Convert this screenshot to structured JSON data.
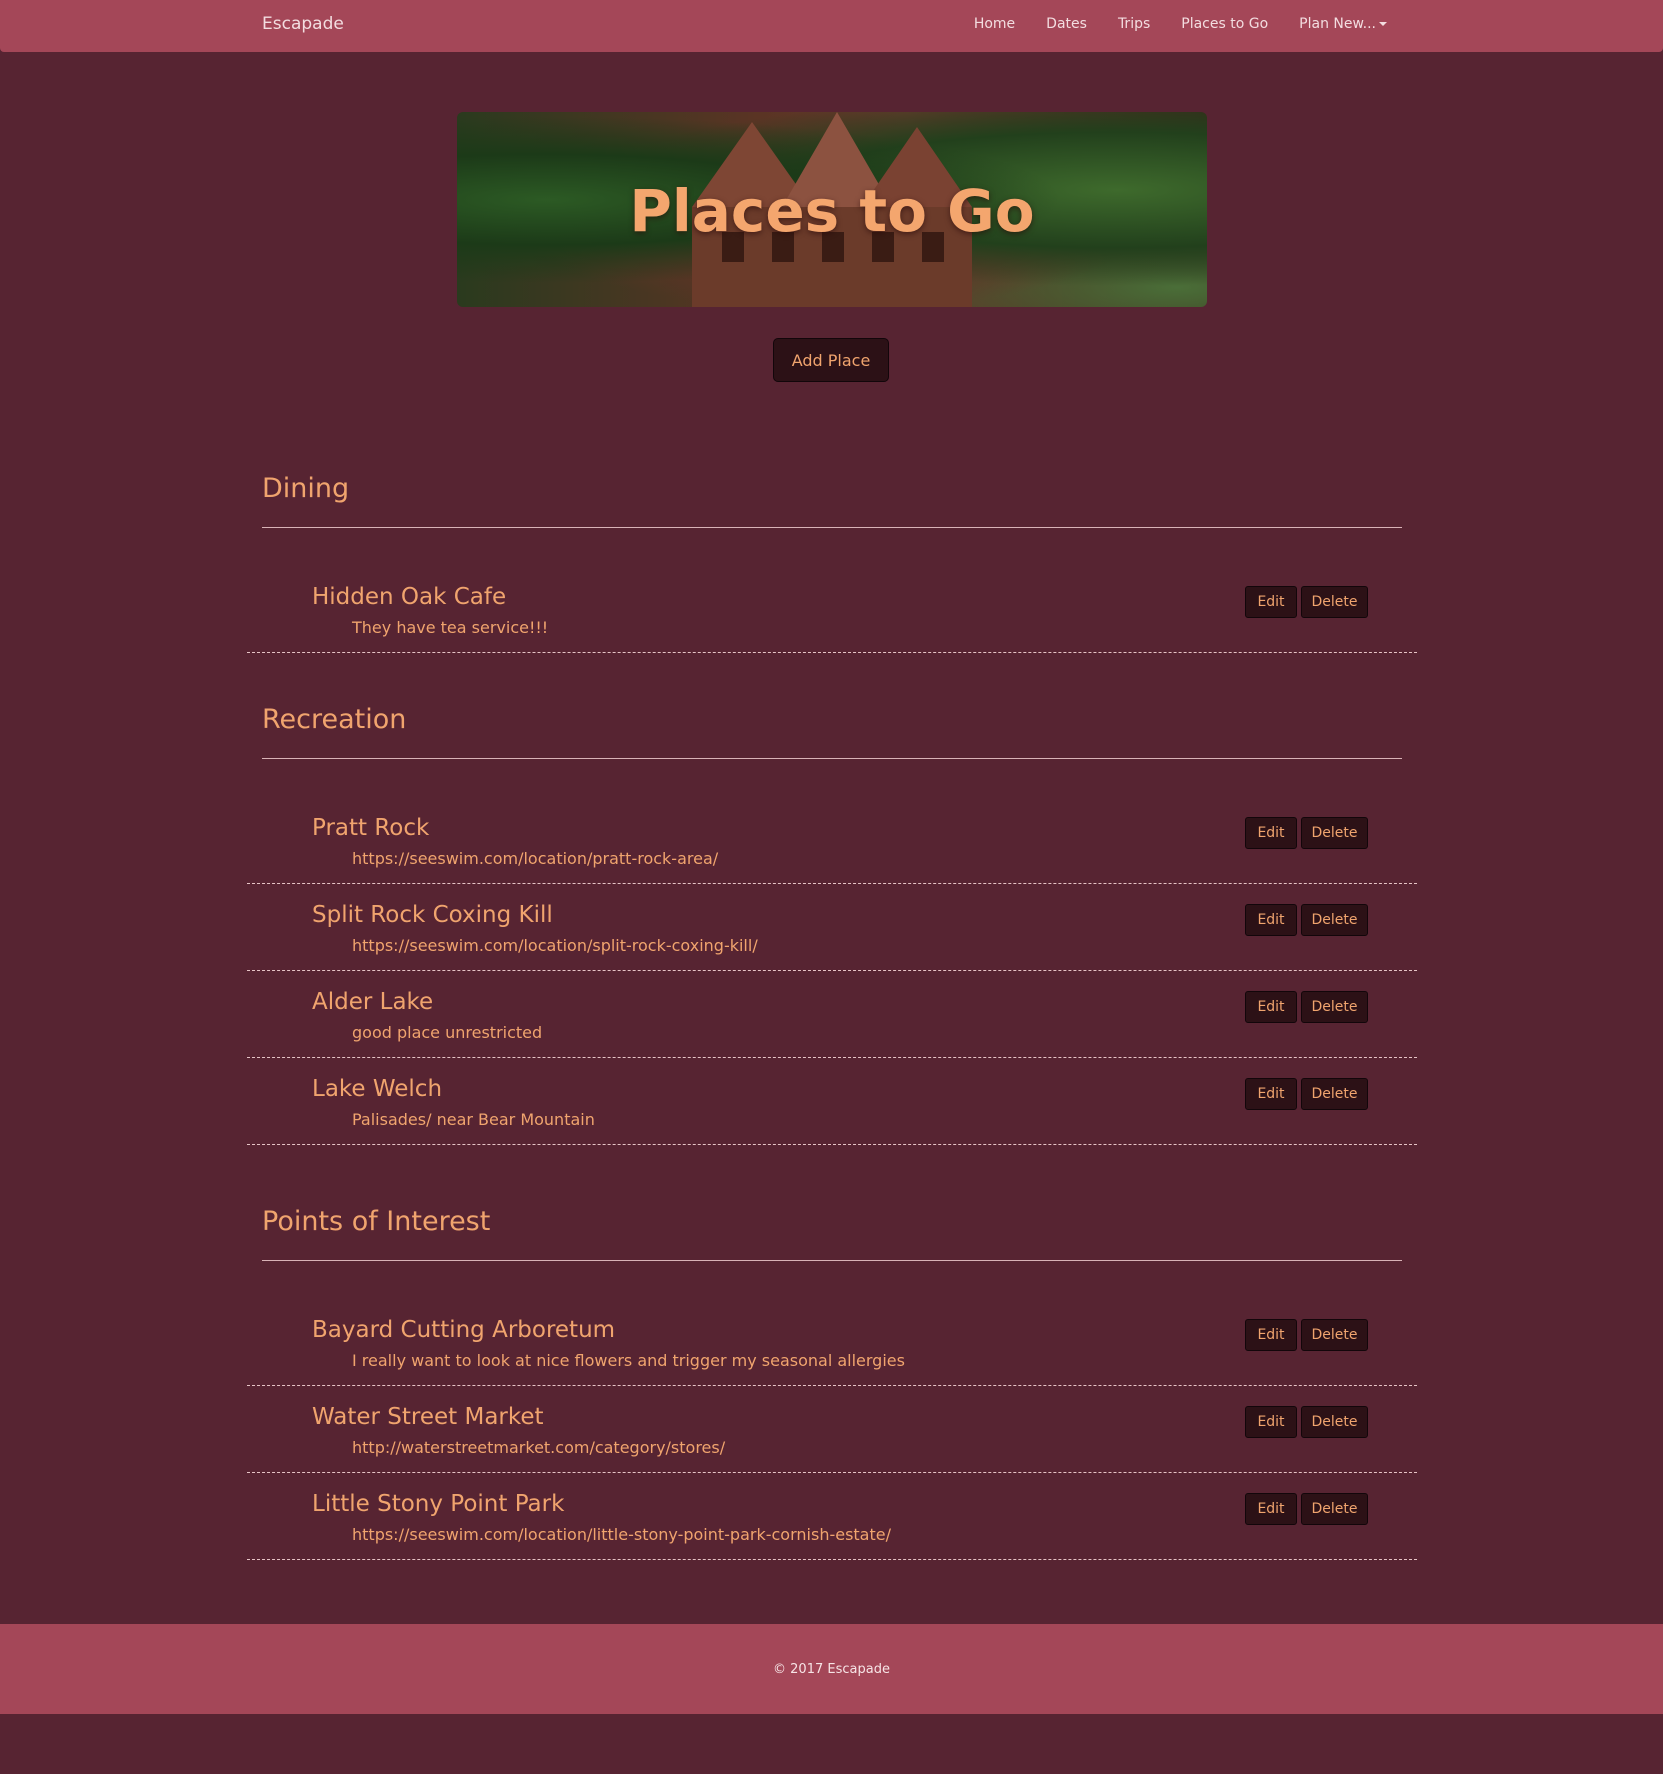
{
  "nav": {
    "brand": "Escapade",
    "links": [
      "Home",
      "Dates",
      "Trips",
      "Places to Go",
      "Plan New..."
    ]
  },
  "hero": {
    "title": "Places to Go"
  },
  "add_button": "Add Place",
  "edit_label": "Edit",
  "delete_label": "Delete",
  "categories": [
    {
      "title": "Dining",
      "places": [
        {
          "name": "Hidden Oak Cafe",
          "desc": "They have tea service!!!"
        }
      ]
    },
    {
      "title": "Recreation",
      "places": [
        {
          "name": "Pratt Rock",
          "desc": "https://seeswim.com/location/pratt-rock-area/"
        },
        {
          "name": "Split Rock Coxing Kill",
          "desc": "https://seeswim.com/location/split-rock-coxing-kill/"
        },
        {
          "name": "Alder Lake",
          "desc": "good place unrestricted"
        },
        {
          "name": "Lake Welch",
          "desc": "Palisades/ near Bear Mountain"
        }
      ]
    },
    {
      "title": "Points of Interest",
      "places": [
        {
          "name": "Bayard Cutting Arboretum",
          "desc": "I really want to look at nice flowers and trigger my seasonal allergies"
        },
        {
          "name": "Water Street Market",
          "desc": "http://waterstreetmarket.com/category/stores/"
        },
        {
          "name": "Little Stony Point Park",
          "desc": "https://seeswim.com/location/little-stony-point-park-cornish-estate/"
        }
      ]
    }
  ],
  "footer": {
    "copyright": "© 2017 Escapade"
  }
}
